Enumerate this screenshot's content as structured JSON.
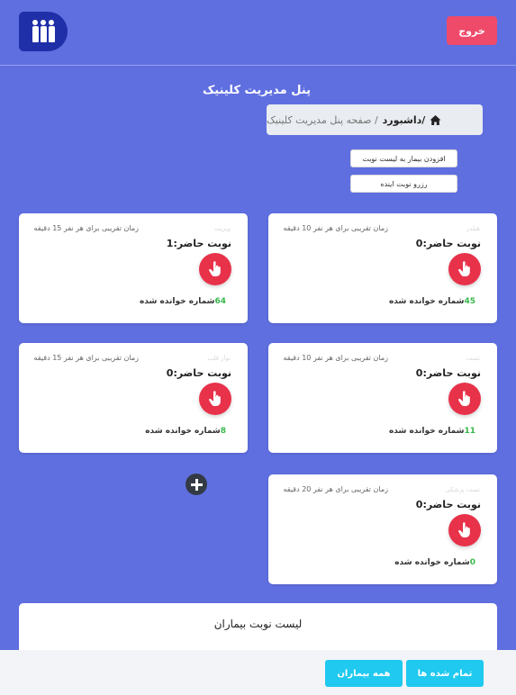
{
  "header": {
    "logout_label": "خروج",
    "logo_icon": "people-icon",
    "accent_color": "#5f6fe0",
    "logout_color": "#ef4a6a"
  },
  "page_title": "پنل مدیریت کلینیک",
  "breadcrumb": {
    "home_icon": "home-icon",
    "link": "/داشبورد",
    "current": "/ صفحه پنل مدیریت کلینیک"
  },
  "actions": {
    "add_patient": "افزودن بیمار به لیست نوبت",
    "reserve": "رزرو نوبت اینده"
  },
  "queues": [
    {
      "name": "هیلدر",
      "wait": "زمان تقریبی برای هر نفر 10 دقیقه",
      "present": "نوبت حاضر:0",
      "read_count": "45",
      "read_label": "شماره خوانده شده"
    },
    {
      "name": "ویزیت",
      "wait": "زمان تقریبی برای هر نفر 15 دقیقه",
      "present": "نوبت حاضر:1",
      "read_count": "64",
      "read_label": "شماره خوانده شده"
    },
    {
      "name": "تست",
      "wait": "زمان تقریبی برای هر نفر 10 دقیقه",
      "present": "نوبت حاضر:0",
      "read_count": "11",
      "read_label": "شماره خوانده شده"
    },
    {
      "name": "نوار قلب",
      "wait": "زمان تقریبی برای هر نفر 15 دقیقه",
      "present": "نوبت حاضر:0",
      "read_count": "8",
      "read_label": "شماره خوانده شده"
    },
    {
      "name": "تست پزشکی",
      "wait": "زمان تقریبی برای هر نفر 20 دقیقه",
      "present": "نوبت حاضر:0",
      "read_count": "0",
      "read_label": "شماره خوانده شده"
    }
  ],
  "add_queue_icon": "plus-circle-icon",
  "patients": {
    "title": "لیست نوبت بیماران",
    "finished_label": "تمام شده ها",
    "all_label": "همه بیماران"
  }
}
